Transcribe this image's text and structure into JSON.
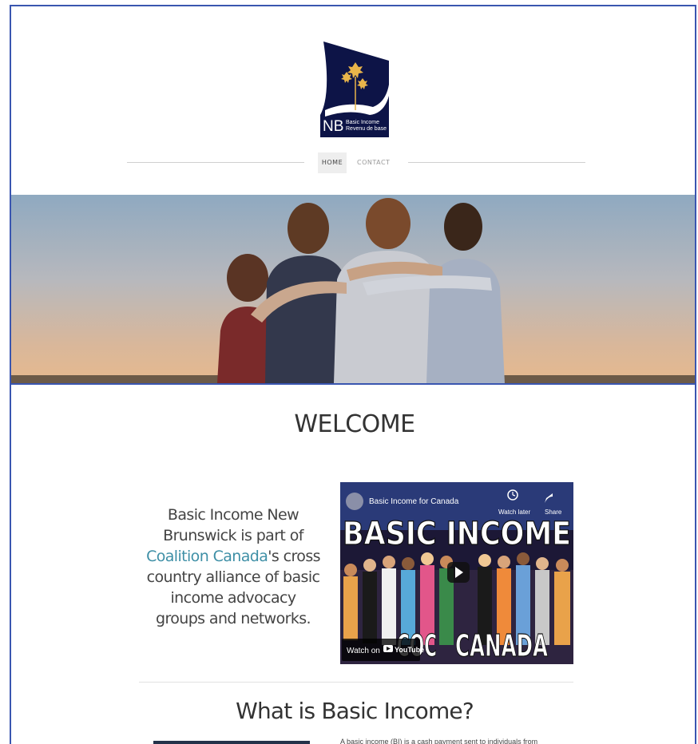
{
  "logo": {
    "mark": "NB",
    "line1": "Basic Income",
    "line2": "Revenu de base"
  },
  "nav": {
    "home": "HOME",
    "contact": "CONTACT"
  },
  "welcome": {
    "title": "WELCOME"
  },
  "intro": {
    "part1": "Basic Income New Brunswick is part of ",
    "link": "Coalition Canada",
    "part2": "'s cross country alliance of basic income advocacy groups and networks."
  },
  "video": {
    "title": "Basic Income for Canada",
    "headline": "BASIC INCOME",
    "footer": "CANADA",
    "footer_partial": "COC",
    "watch_later": "Watch later",
    "share": "Share",
    "watch_on": "Watch on",
    "youtube": "YouTube"
  },
  "section2": {
    "title": "What is Basic Income?",
    "text": "A basic income (BI) is a cash payment sent to individuals from"
  },
  "colors": {
    "frame": "#3a56b0",
    "link": "#3e8fa6",
    "logo_navy": "#0d1447",
    "logo_gold": "#e9b54a"
  }
}
